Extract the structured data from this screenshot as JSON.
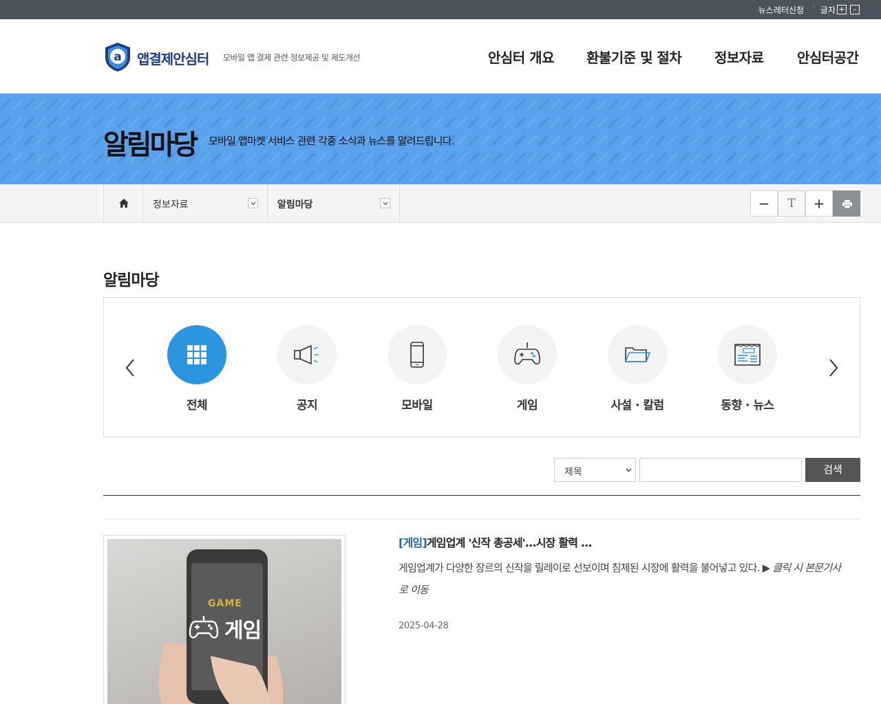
{
  "topbar": {
    "newsletter": "뉴스레터신청",
    "separator": "·",
    "font_label": "글자",
    "font_plus": "+",
    "font_minus": "-"
  },
  "header": {
    "logo_name": "앱결제안심터",
    "slogan": "모바일 앱 결제 관련 정보제공 및 제도개선",
    "nav": [
      "안심터 개요",
      "환불기준 및 절차",
      "정보자료",
      "안심터공간"
    ]
  },
  "banner": {
    "title": "알림마당",
    "subtitle": "모바일 앱마켓 서비스 관련 각종 소식과 뉴스를 알려드립니다."
  },
  "breadcrumb": {
    "level1": "정보자료",
    "level2": "알림마당"
  },
  "tools": {
    "minus": "−",
    "text": "T",
    "plus": "+"
  },
  "section_title": "알림마당",
  "categories": [
    {
      "label": "전체",
      "icon": "grid-icon",
      "active": true
    },
    {
      "label": "공지",
      "icon": "megaphone-icon",
      "active": false
    },
    {
      "label": "모바일",
      "icon": "mobile-phone-icon",
      "active": false
    },
    {
      "label": "게임",
      "icon": "game-controller-icon",
      "active": false
    },
    {
      "label": "사설 · 칼럼",
      "icon": "folder-icon",
      "active": false
    },
    {
      "label": "동향 · 뉴스",
      "icon": "newspaper-icon",
      "active": false
    }
  ],
  "search": {
    "field_selected": "제목",
    "query": "",
    "button": "검색"
  },
  "article": {
    "thumb_label": "게임",
    "thumb_text": "GAME",
    "category": "[게임]",
    "title": "게임업계 '신작 총공세'...시장 활력 ...",
    "summary": "게임업계가 다양한 장르의 신작을 릴레이로 선보이며 침체된 시장에 활력을 불어넣고 있다. ▶",
    "more_link": "클릭 시 본문기사로 이동",
    "date": "2025-04-28"
  },
  "colors": {
    "topbar": "#4b535c",
    "banner": "#5aa2ec",
    "active_category": "#2b96e0",
    "category_tag": "#1f66b8",
    "search_button": "#555555"
  }
}
